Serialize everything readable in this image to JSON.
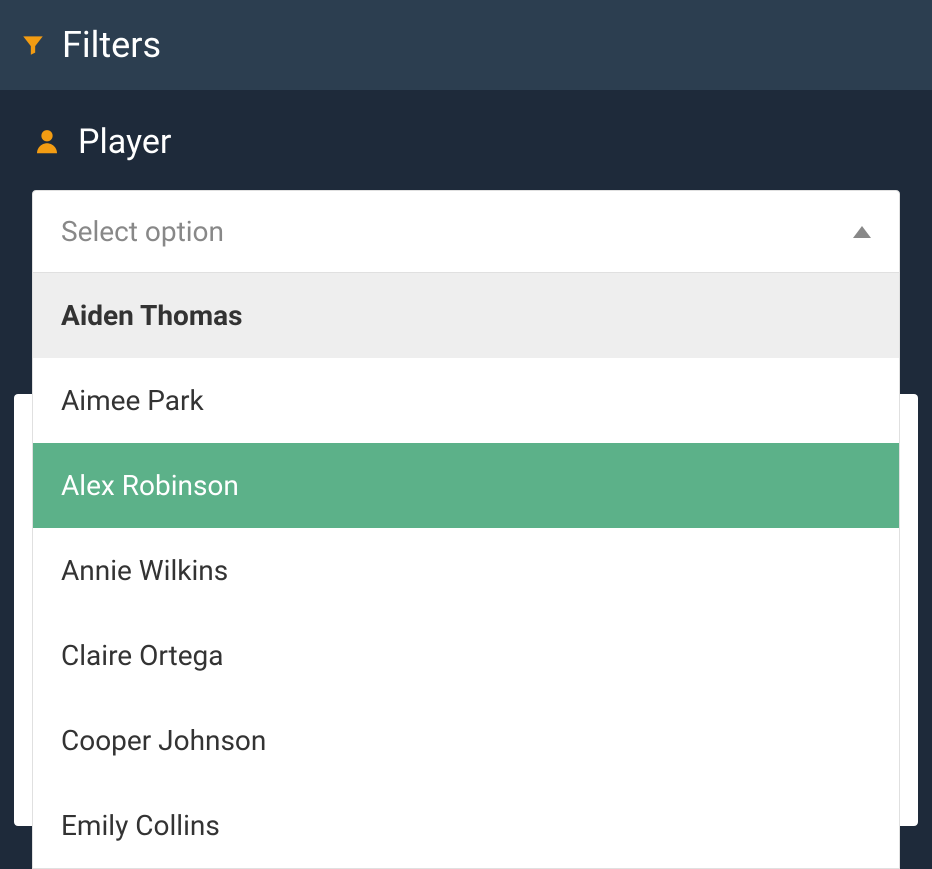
{
  "header": {
    "title": "Filters"
  },
  "player_section": {
    "title": "Player",
    "placeholder": "Select option",
    "options": [
      {
        "label": "Aiden Thomas",
        "state": "hovered"
      },
      {
        "label": "Aimee Park",
        "state": "normal"
      },
      {
        "label": "Alex Robinson",
        "state": "selected"
      },
      {
        "label": "Annie Wilkins",
        "state": "normal"
      },
      {
        "label": "Claire Ortega",
        "state": "normal"
      },
      {
        "label": "Cooper Johnson",
        "state": "normal"
      },
      {
        "label": "Emily Collins",
        "state": "normal"
      }
    ]
  }
}
